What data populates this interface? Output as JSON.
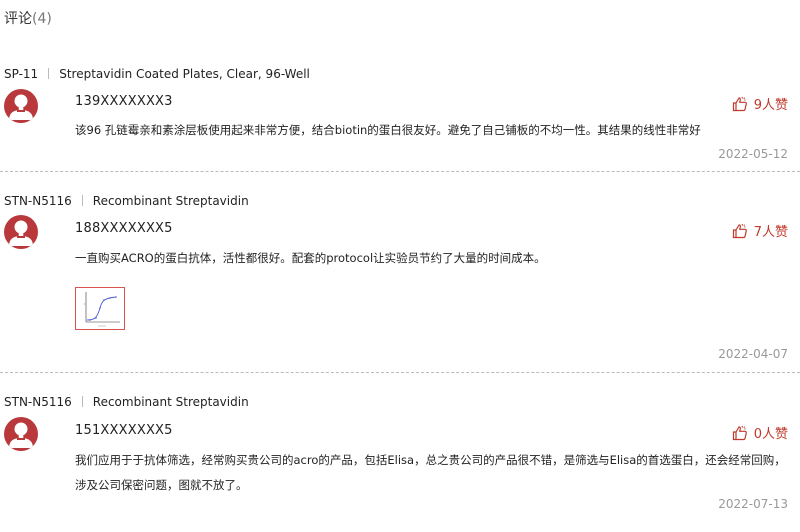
{
  "header": {
    "title": "评论",
    "count": "(4)"
  },
  "reviews": [
    {
      "product_code": "SP-11",
      "product_name": "Streptavidin Coated Plates, Clear, 96-Well",
      "user": "139XXXXXXX3",
      "likes": "9人赞",
      "text": "该96 孔链霉亲和素涂层板使用起来非常方便，结合biotin的蛋白很友好。避免了自己铺板的不均一性。其结果的线性非常好",
      "date": "2022-05-12"
    },
    {
      "product_code": "STN-N5116",
      "product_name": "Recombinant Streptavidin",
      "user": "188XXXXXXX5",
      "likes": "7人赞",
      "text": "一直购买ACRO的蛋白抗体，活性都很好。配套的protocol让实验员节约了大量的时间成本。",
      "date": "2022-04-07"
    },
    {
      "product_code": "STN-N5116",
      "product_name": "Recombinant Streptavidin",
      "user": "151XXXXXXX5",
      "likes": "0人赞",
      "text": "我们应用于于抗体筛选，经常购买贵公司的acro的产品，包括Elisa，总之贵公司的产品很不错，是筛选与Elisa的首选蛋白，还会经常回购，涉及公司保密问题，图就不放了。",
      "date": "2022-07-13"
    }
  ],
  "colors": {
    "accent": "#c0392b",
    "avatar_bg": "#b8383c",
    "muted": "#999999"
  },
  "icons": {
    "like": "thumbs-up-icon",
    "avatar": "user-avatar-icon"
  }
}
